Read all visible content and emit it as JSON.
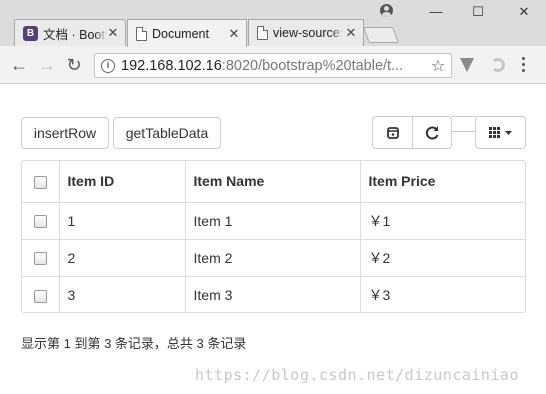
{
  "browser": {
    "tabs": [
      {
        "title": "文档 · Bootstrap Table",
        "favicon": "bootstrap-icon",
        "active": false
      },
      {
        "title": "Document",
        "favicon": "document-icon",
        "active": true
      },
      {
        "title": "view-source:",
        "favicon": "document-icon",
        "active": false
      }
    ],
    "tab_close_glyph": "✕",
    "bootstrap_favicon_letter": "B",
    "window_controls": {
      "minimize": "—",
      "maximize": "☐",
      "close": "✕"
    },
    "nav": {
      "back": "←",
      "forward": "→",
      "reload": "↻"
    },
    "address": {
      "host": "192.168.102.16",
      "rest": ":8020/bootstrap%20table/t...",
      "info_glyph": "i",
      "star": "☆"
    }
  },
  "toolbar": {
    "insert_row": "insertRow",
    "get_table_data": "getTableData"
  },
  "table": {
    "columns": [
      "Item ID",
      "Item Name",
      "Item Price"
    ],
    "rows": [
      {
        "id": "1",
        "name": "Item 1",
        "price": "￥1"
      },
      {
        "id": "2",
        "name": "Item 2",
        "price": "￥2"
      },
      {
        "id": "3",
        "name": "Item 3",
        "price": "￥3"
      }
    ]
  },
  "pagination": {
    "summary": "显示第 1 到第 3 条记录，总共 3 条记录"
  },
  "watermark": "https://blog.csdn.net/dizuncainiao",
  "colors": {
    "chrome_bg": "#dcdcdc",
    "border": "#dddddd",
    "bootstrap_purple": "#563d7c"
  }
}
